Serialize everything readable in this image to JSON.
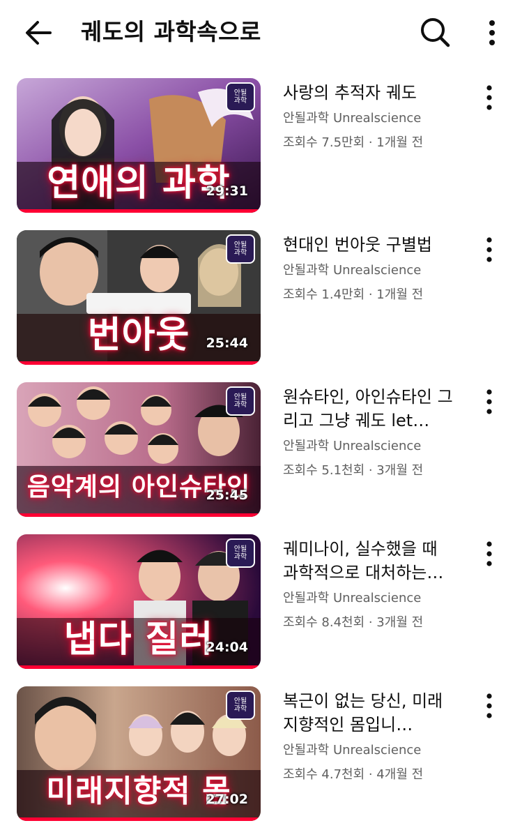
{
  "header": {
    "title": "궤도의 과학속으로",
    "back_icon": "arrow-left-icon",
    "search_icon": "search-icon",
    "more_icon": "more-vertical-icon"
  },
  "videos": [
    {
      "title": "사랑의 추적자 궤도",
      "channel": "안될과학 Unrealscience",
      "meta": "조회수 7.5만회 · 1개월 전",
      "duration": "29:31",
      "thumb_caption": "연애의 과학"
    },
    {
      "title": "현대인 번아웃 구별법",
      "channel": "안될과학 Unrealscience",
      "meta": "조회수 1.4만회 · 1개월 전",
      "duration": "25:44",
      "thumb_caption": "번아웃"
    },
    {
      "title": "원슈타인, 아인슈타인 그리고 그냥 궤도 let…",
      "channel": "안될과학 Unrealscience",
      "meta": "조회수 5.1천회 · 3개월 전",
      "duration": "25:45",
      "thumb_caption": "음악계의 아인슈타인"
    },
    {
      "title": "궤미나이, 실수했을 때 과학적으로 대처하는…",
      "channel": "안될과학 Unrealscience",
      "meta": "조회수 8.4천회 · 3개월 전",
      "duration": "24:04",
      "thumb_caption": "냅다 질러"
    },
    {
      "title": "복근이 없는 당신, 미래지향적인 몸입니…",
      "channel": "안될과학 Unrealscience",
      "meta": "조회수 4.7천회 · 4개월 전",
      "duration": "27:02",
      "thumb_caption": "미래지향적 몸"
    }
  ],
  "colors": {
    "progress": "#ff0033",
    "secondary_text": "#606060",
    "primary_text": "#0f0f0f"
  }
}
